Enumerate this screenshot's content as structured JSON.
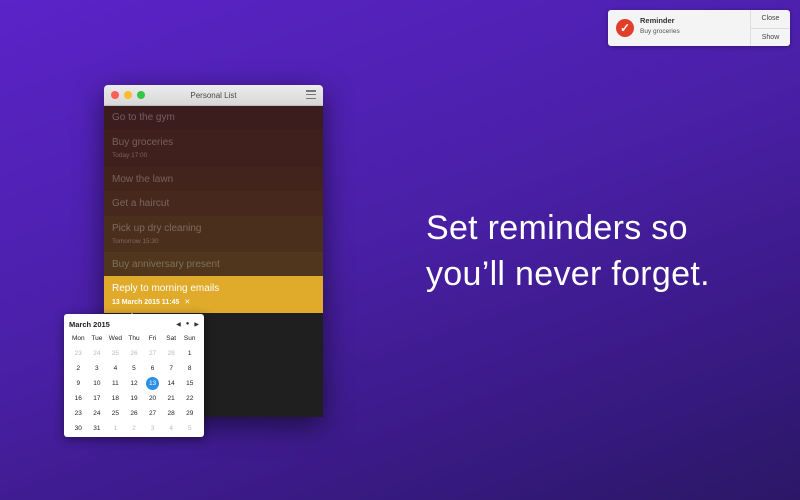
{
  "notification": {
    "title": "Reminder",
    "subtitle": "Buy groceries",
    "close_label": "Close",
    "show_label": "Show",
    "icon": "checkmark-icon",
    "icon_color": "#e0402a"
  },
  "headline": {
    "line1": "Set reminders so",
    "line2": "you’ll never forget."
  },
  "window": {
    "title": "Personal List"
  },
  "tasks": [
    {
      "title": "Go to the gym",
      "subtitle": "",
      "color": "#3c1d1d"
    },
    {
      "title": "Buy groceries",
      "subtitle": "Today 17:00",
      "color": "#3f201c"
    },
    {
      "title": "Mow the lawn",
      "subtitle": "",
      "color": "#42241c"
    },
    {
      "title": "Get a haircut",
      "subtitle": "",
      "color": "#46291c"
    },
    {
      "title": "Pick up dry cleaning",
      "subtitle": "Tomorrow 15:30",
      "color": "#4a2f1c"
    },
    {
      "title": "Buy anniversary present",
      "subtitle": "",
      "color": "#4f361c"
    },
    {
      "title": "Reply to morning emails",
      "subtitle": "13 March 2015 11:45",
      "color": "#e0aa2a"
    }
  ],
  "calendar": {
    "month": "March 2015",
    "prev": "◀",
    "today": "●",
    "next": "▶",
    "weekdays": [
      "Mon",
      "Tue",
      "Wed",
      "Thu",
      "Fri",
      "Sat",
      "Sun"
    ],
    "days": [
      "23",
      "24",
      "25",
      "26",
      "27",
      "28",
      "1",
      "2",
      "3",
      "4",
      "5",
      "6",
      "7",
      "8",
      "9",
      "10",
      "11",
      "12",
      "13",
      "14",
      "15",
      "16",
      "17",
      "18",
      "19",
      "20",
      "21",
      "22",
      "23",
      "24",
      "25",
      "26",
      "27",
      "28",
      "29",
      "30",
      "31",
      "1",
      "2",
      "3",
      "4",
      "5"
    ],
    "muted": [
      0,
      1,
      2,
      3,
      4,
      5,
      37,
      38,
      39,
      40,
      41
    ],
    "selected": 18,
    "accent": "#2a8fe6"
  }
}
